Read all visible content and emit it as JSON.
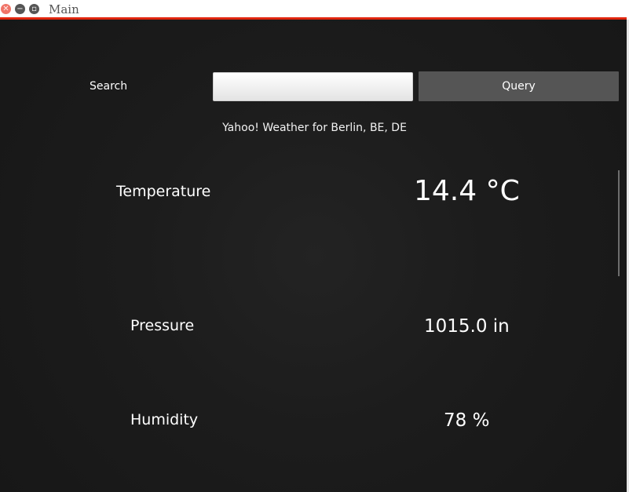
{
  "window": {
    "title": "Main"
  },
  "search": {
    "label": "Search",
    "value": "",
    "placeholder": "",
    "button_label": "Query"
  },
  "source": {
    "text": "Yahoo! Weather for Berlin, BE, DE"
  },
  "readings": {
    "temperature": {
      "label": "Temperature",
      "value": "14.4 °C"
    },
    "pressure": {
      "label": "Pressure",
      "value": "1015.0 in"
    },
    "humidity": {
      "label": "Humidity",
      "value": "78 %"
    }
  },
  "colors": {
    "titlebar_accent": "#e0260f",
    "background": "#1b1b1b",
    "button": "#555555",
    "text": "#ffffff"
  }
}
